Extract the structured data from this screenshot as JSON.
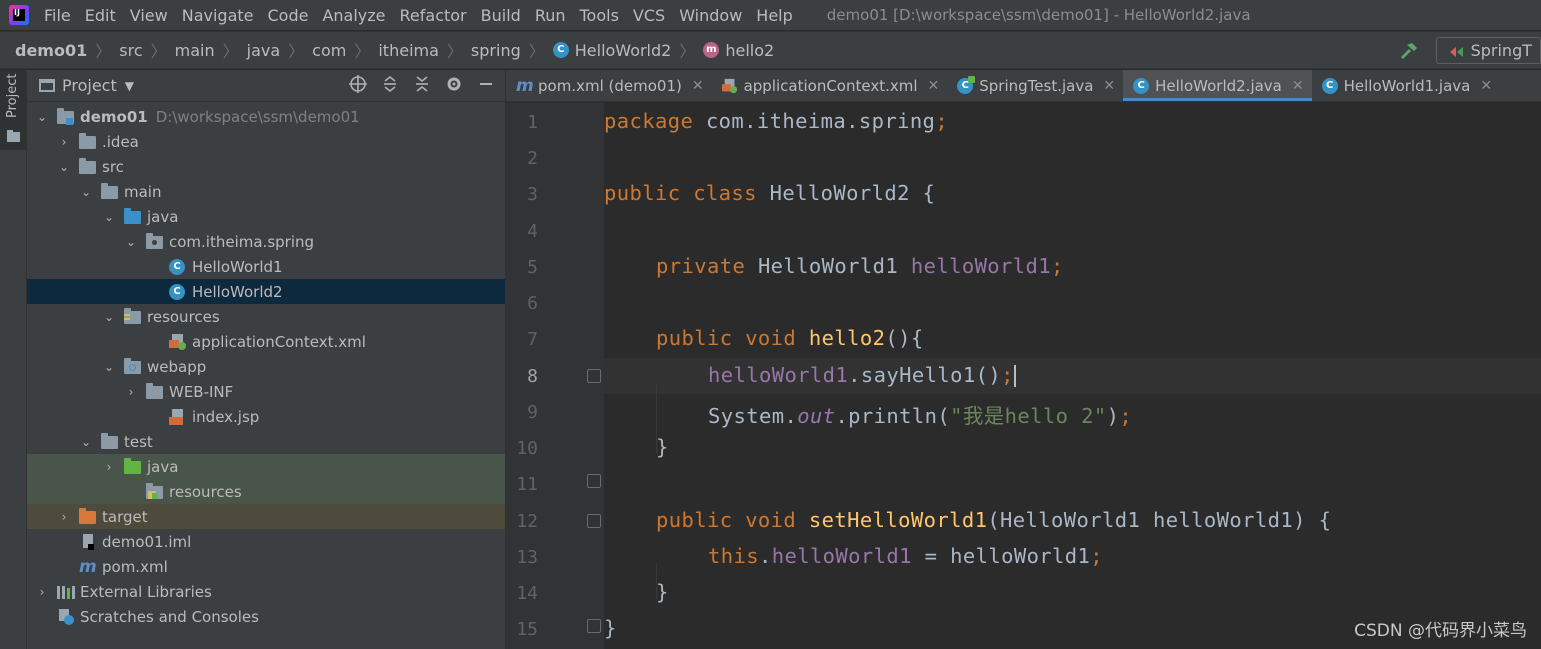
{
  "menubar": {
    "logo_text": "IJ",
    "items": [
      "File",
      "Edit",
      "View",
      "Navigate",
      "Code",
      "Analyze",
      "Refactor",
      "Build",
      "Run",
      "Tools",
      "VCS",
      "Window",
      "Help"
    ],
    "window_title": "demo01 [D:\\workspace\\ssm\\demo01] - HelloWorld2.java"
  },
  "breadcrumb": [
    "demo01",
    "src",
    "main",
    "java",
    "com",
    "itheima",
    "spring",
    "HelloWorld2",
    "hello2"
  ],
  "run_config": {
    "label": "SpringT"
  },
  "tool_strip": {
    "project_label": "Project"
  },
  "project_panel": {
    "title": "Project",
    "tree": [
      {
        "label": "demo01",
        "hint": "D:\\workspace\\ssm\\demo01"
      },
      {
        "label": ".idea"
      },
      {
        "label": "src"
      },
      {
        "label": "main"
      },
      {
        "label": "java"
      },
      {
        "label": "com.itheima.spring"
      },
      {
        "label": "HelloWorld1"
      },
      {
        "label": "HelloWorld2"
      },
      {
        "label": "resources"
      },
      {
        "label": "applicationContext.xml"
      },
      {
        "label": "webapp"
      },
      {
        "label": "WEB-INF"
      },
      {
        "label": "index.jsp"
      },
      {
        "label": "test"
      },
      {
        "label": "java"
      },
      {
        "label": "resources"
      },
      {
        "label": "target"
      },
      {
        "label": "demo01.iml"
      },
      {
        "label": "pom.xml"
      },
      {
        "label": "External Libraries"
      },
      {
        "label": "Scratches and Consoles"
      }
    ]
  },
  "editor": {
    "tabs": [
      "pom.xml (demo01)",
      "applicationContext.xml",
      "SpringTest.java",
      "HelloWorld2.java",
      "HelloWorld1.java"
    ],
    "active_tab": "HelloWorld2.java",
    "current_line": 8,
    "line_numbers": [
      "1",
      "2",
      "3",
      "4",
      "5",
      "6",
      "7",
      "8",
      "9",
      "10",
      "11",
      "12",
      "13",
      "14",
      "15"
    ],
    "code": {
      "l1_kw": "package",
      "l1_rest": " com.itheima.spring",
      "l1_semi": ";",
      "l3_kw": "public class",
      "l3_rest": " HelloWorld2 {",
      "l5_kw": "private",
      "l5_type": " HelloWorld1 ",
      "l5_field": "helloWorld1",
      "l5_semi": ";",
      "l7_kw": "public void",
      "l7_fn": "hello2",
      "l7_rest": "(){",
      "l8_field": "helloWorld1",
      "l8_rest": ".sayHello1()",
      "l8_semi": ";",
      "l9_a": "System.",
      "l9_out": "out",
      "l9_b": ".println(",
      "l9_str": "\"我是hello 2\"",
      "l9_c": ")",
      "l9_semi": ";",
      "l10": "}",
      "l12_kw": "public void",
      "l12_fn": "setHelloWorld1",
      "l12_rest": "(HelloWorld1 helloWorld1) {",
      "l13_kw": "this",
      "l13_dot": ".",
      "l13_field": "helloWorld1",
      "l13_rest": " = helloWorld1",
      "l13_semi": ";",
      "l14": "}",
      "l15": "}"
    }
  },
  "watermark": "CSDN @代码界小菜鸟"
}
